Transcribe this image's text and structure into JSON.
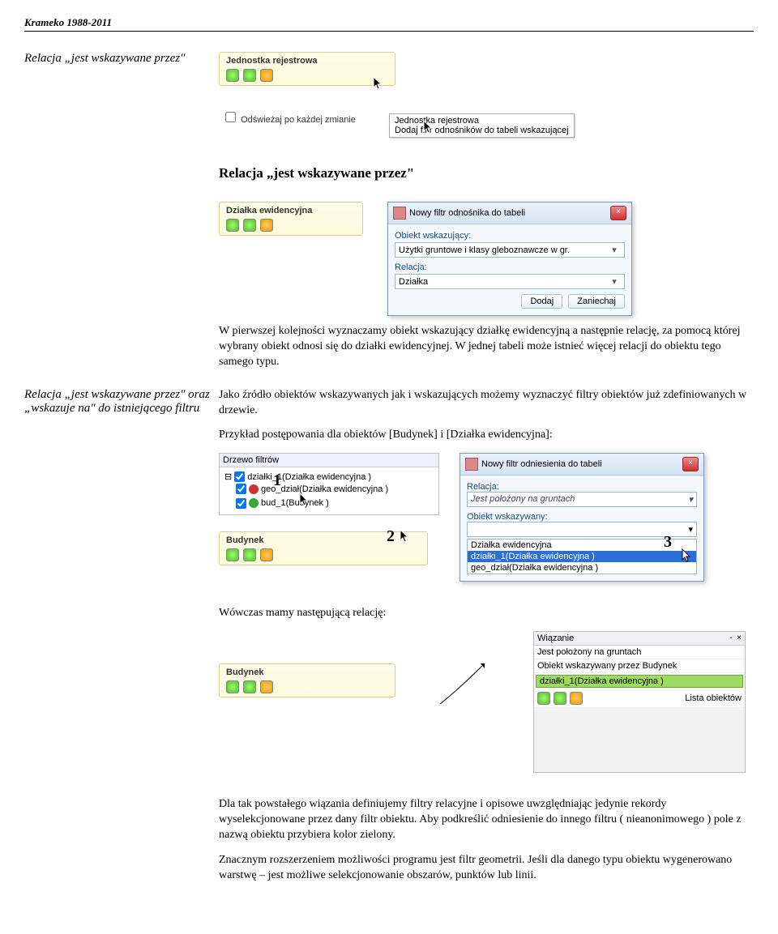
{
  "doc": {
    "header": "Krameko 1988-2011",
    "sec1_left": "Relacja „jest wskazywane przez\"",
    "shot1": {
      "title": "Jednostka rejestrowa"
    },
    "checkbox_label": "Odświeżaj po każdej zmianie",
    "tooltip1_l1": "Jednostka rejestrowa",
    "tooltip1_l2": "Dodaj filtr odnośników do tabeli wskazującej",
    "sec2_heading": "Relacja „jest wskazywane przez\"",
    "shot2": {
      "title": "Działka ewidencyjna"
    },
    "dialog1": {
      "title": "Nowy filtr odnośnika do tabeli",
      "label1": "Obiekt wskazujący:",
      "combo1": "Użytki gruntowe i klasy gleboznawcze w gr.",
      "label2": "Relacja:",
      "combo2": "Działka",
      "btn_add": "Dodaj",
      "btn_cancel": "Zaniechaj"
    },
    "p1": "W pierwszej kolejności wyznaczamy obiekt wskazujący działkę ewidencyjną a następnie relację, za pomocą której wybrany obiekt odnosi się do działki ewidencyjnej. W jednej tabeli może istnieć więcej relacji do obiektu tego samego typu.",
    "sec3_left": "Relacja „jest wskazywane przez\" oraz „wskazuje na\" do istniejącego filtru",
    "p2": "Jako źródło obiektów wskazywanych jak i wskazujących możemy wyznaczyć filtry obiektów już zdefiniowanych w drzewie.",
    "p3": "Przykład postępowania dla obiektów [Budynek] i [Działka ewidencyjna]:",
    "tree": {
      "title": "Drzewo filtrów",
      "i1": "działki_1(Działka ewidencyjna )",
      "i2": "geo_dział(Działka ewidencyjna )",
      "i3": "bud_1(Budynek )",
      "box_label": "Budynek"
    },
    "dialog2": {
      "title": "Nowy filtr odniesienia do tabeli",
      "label1": "Relacja:",
      "combo1": "Jest położony na gruntach",
      "label2": "Obiekt wskazywany:",
      "opt1": "Działka ewidencyjna",
      "opt2": "działki_1(Działka ewidencyjna )",
      "opt3": "geo_dział(Działka ewidencyjna )"
    },
    "p4": "Wówczas mamy następującą relację:",
    "wpanel": {
      "head": "Wiązanie",
      "r1": "Jest położony na gruntach",
      "r2": "Obiekt wskazywany przez Budynek",
      "r3": "działki_1(Działka ewidencyjna )",
      "r4": "Lista obiektów"
    },
    "shot_bud": {
      "title": "Budynek"
    },
    "p5": "Dla tak powstałego wiązania definiujemy filtry relacyjne i opisowe uwzględniając jedynie rekordy wyselekcjonowane przez dany filtr obiektu. Aby podkreślić odniesienie do innego filtru ( nieanonimowego ) pole z nazwą obiektu przybiera kolor zielony.",
    "p6": "Znacznym rozszerzeniem możliwości programu jest filtr geometrii. Jeśli dla danego typu obiektu wygenerowano warstwę – jest możliwe selekcjonowanie obszarów, punktów lub linii."
  },
  "nums": {
    "n1": "1",
    "n2": "2",
    "n3": "3"
  }
}
